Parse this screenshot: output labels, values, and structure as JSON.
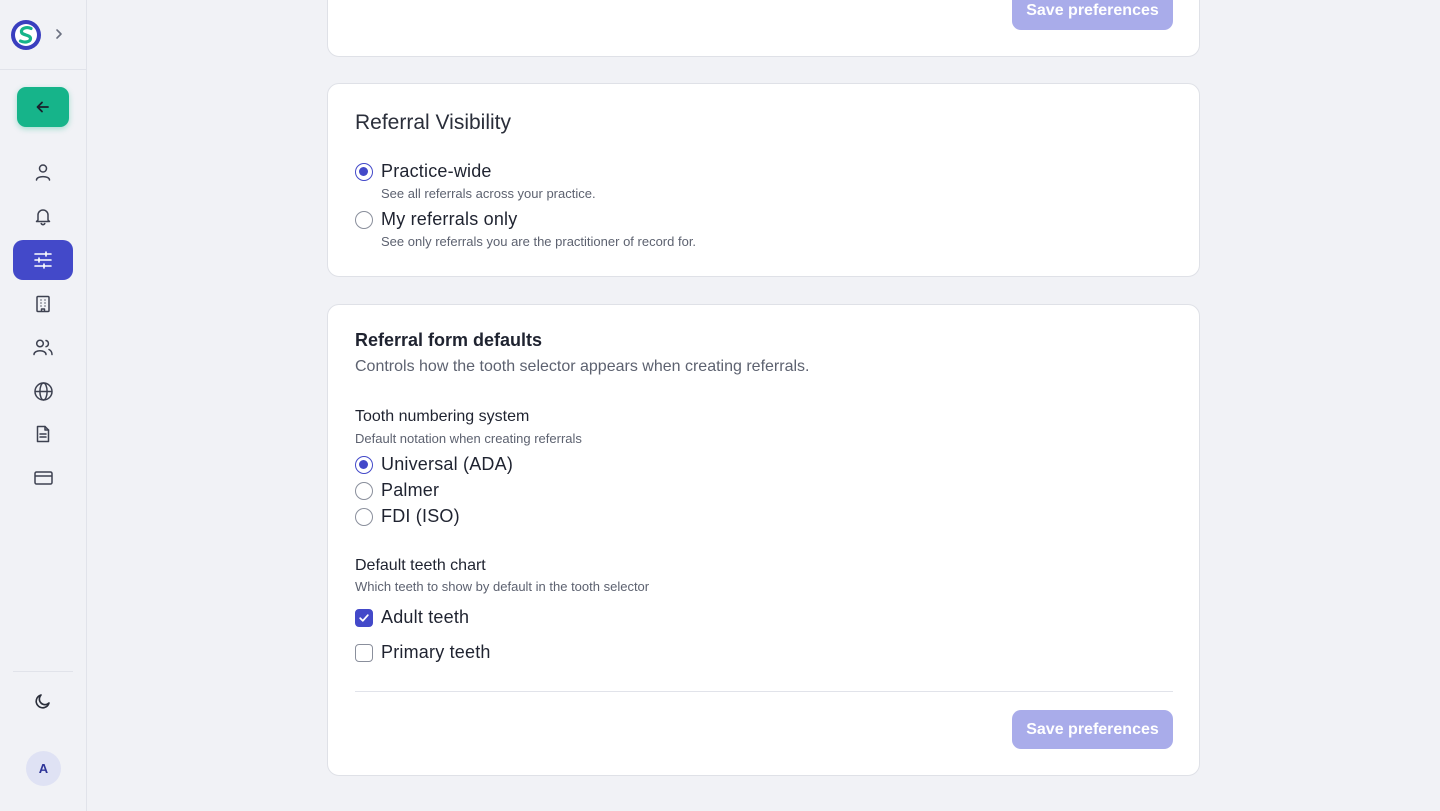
{
  "sidebar": {
    "nav_icons": [
      "user-icon",
      "bell-icon",
      "sliders-icon",
      "building-icon",
      "users-icon",
      "globe-icon",
      "document-icon",
      "credit-card-icon"
    ],
    "active_item": "sliders-icon",
    "avatar_initial": "A",
    "colors": {
      "accent": "#4349c9",
      "back_button": "#16b48a"
    }
  },
  "top_card": {
    "save_label": "Save preferences"
  },
  "visibility_card": {
    "title": "Referral Visibility",
    "options": [
      {
        "label": "Practice-wide",
        "description": "See all referrals across your practice.",
        "selected": true
      },
      {
        "label": "My referrals only",
        "description": "See only referrals you are the practitioner of record for.",
        "selected": false
      }
    ]
  },
  "form_defaults_card": {
    "title": "Referral form defaults",
    "subtitle": "Controls how the tooth selector appears when creating referrals.",
    "numbering": {
      "label": "Tooth numbering system",
      "help": "Default notation when creating referrals",
      "options": [
        {
          "label": "Universal (ADA)",
          "selected": true
        },
        {
          "label": "Palmer",
          "selected": false
        },
        {
          "label": "FDI (ISO)",
          "selected": false
        }
      ]
    },
    "teeth_chart": {
      "label": "Default teeth chart",
      "help": "Which teeth to show by default in the tooth selector",
      "options": [
        {
          "label": "Adult teeth",
          "checked": true
        },
        {
          "label": "Primary teeth",
          "checked": false
        }
      ]
    },
    "save_label": "Save preferences"
  }
}
